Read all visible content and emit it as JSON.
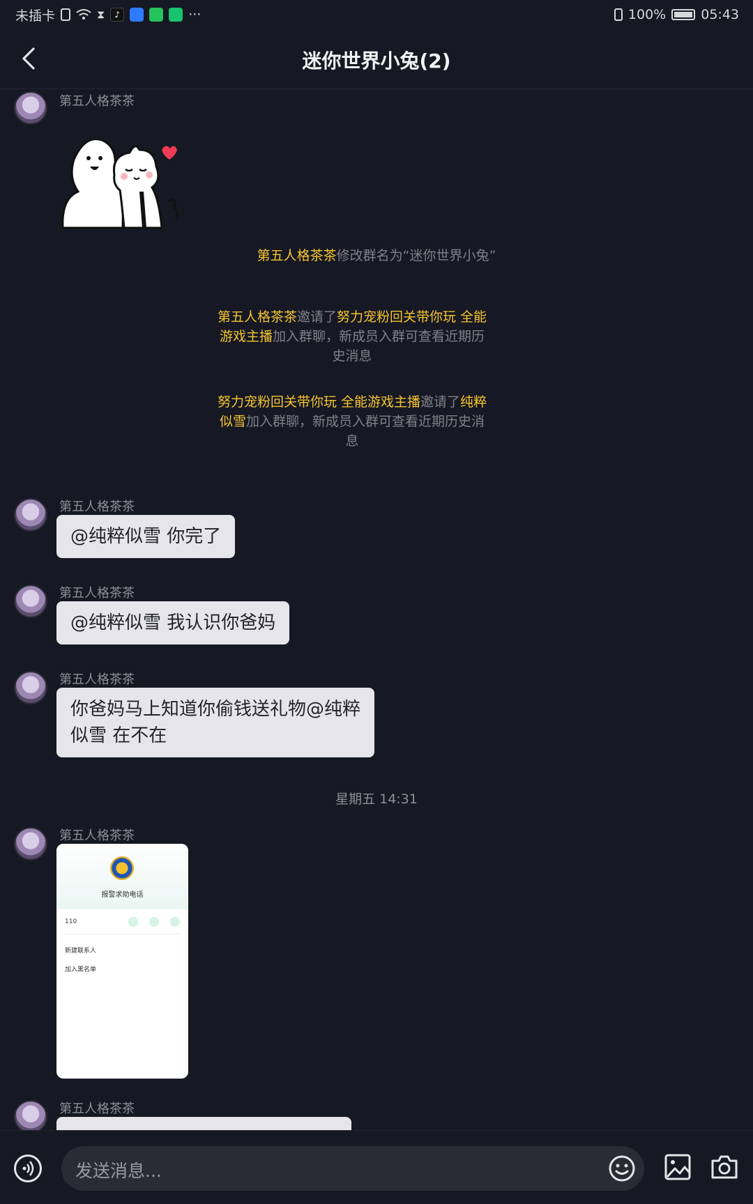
{
  "status_bar": {
    "carrier": "未插卡",
    "battery": "100%",
    "time": "05:43"
  },
  "header": {
    "title": "迷你世界小兔(2)"
  },
  "messages": {
    "m1": {
      "sender": "第五人格茶茶"
    },
    "sys1": {
      "actor": "第五人格茶茶",
      "text": "修改群名为“迷你世界小兔”"
    },
    "sys2": {
      "actor": "第五人格茶茶",
      "verb": "邀请了",
      "target": "努力宠粉回关带你玩  全能游戏主播",
      "tail": "加入群聊，新成员入群可查看近期历史消息"
    },
    "sys3": {
      "actor": "努力宠粉回关带你玩  全能游戏主播",
      "verb": "邀请了",
      "target": "纯粹似雪",
      "tail": "加入群聊，新成员入群可查看近期历史消息"
    },
    "m2": {
      "sender": "第五人格茶茶",
      "text": "@纯粹似雪 你完了"
    },
    "m3": {
      "sender": "第五人格茶茶",
      "text": "@纯粹似雪 我认识你爸妈"
    },
    "m4": {
      "sender": "第五人格茶茶",
      "text": "你爸妈马上知道你偷钱送礼物@纯粹似雪 在不在"
    },
    "time_divider": "星期五 14:31",
    "m5": {
      "sender": "第五人格茶茶",
      "card": {
        "title": "报警求助电话",
        "number": "110",
        "option1": "新建联系人",
        "option2": "加入黑名单"
      }
    },
    "m6": {
      "sender": "第五人格茶茶"
    }
  },
  "input": {
    "placeholder": "发送消息..."
  },
  "colors": {
    "background": "#161823",
    "highlight": "#f4c430",
    "bubble": "#e6e6ea"
  }
}
